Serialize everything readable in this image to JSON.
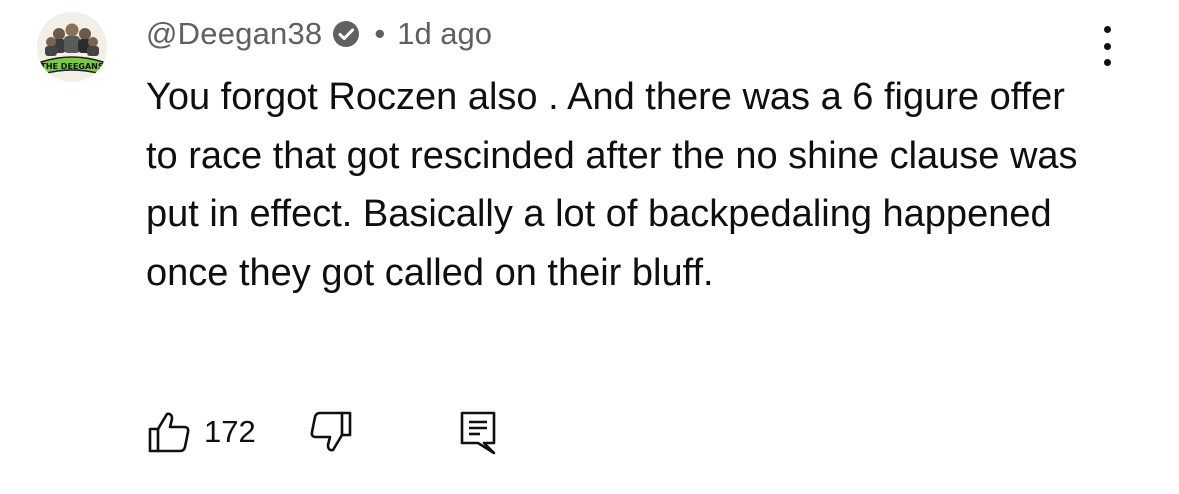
{
  "comment": {
    "author": "@Deegan38",
    "verified": true,
    "separator": "•",
    "time": "1d ago",
    "text": "You forgot Roczen also . And there was a 6 figure offer to race that got rescinded after the no shine clause was put in effect. Basically a lot of backpedaling happened once they got called on their bluff.",
    "likes": "172",
    "avatar_text": "THE DEEGANS"
  },
  "colors": {
    "text": "#0f0f0f",
    "meta": "#606060",
    "avatar_green": "#7ac943"
  },
  "icons": {
    "verified": "verified-check-icon",
    "menu": "more-vertical-icon",
    "like": "thumbs-up-icon",
    "dislike": "thumbs-down-icon",
    "reply": "comment-reply-icon"
  }
}
